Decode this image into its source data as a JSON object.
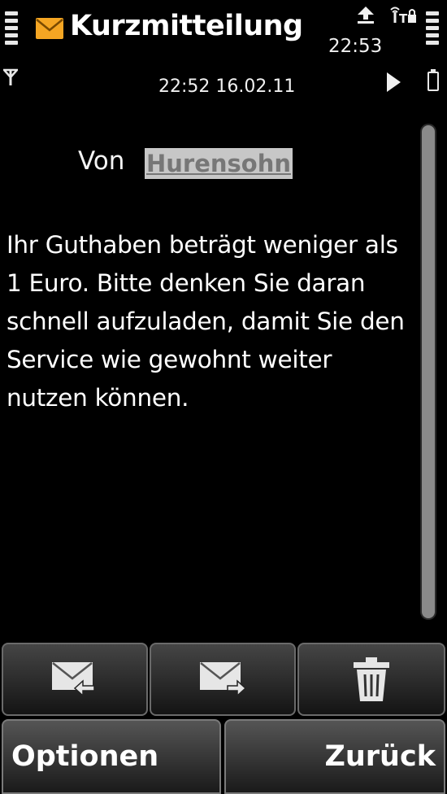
{
  "header": {
    "title": "Kurzmitteilung",
    "clock": "22:53",
    "datetime": "22:52 16.02.11"
  },
  "message": {
    "from_label": "Von",
    "sender": "Hurensohn",
    "body": "Ihr Guthaben beträgt weniger als\n1 Euro. Bitte denken Sie daran\nschnell aufzuladen, damit Sie den\nService wie gewohnt weiter\nnutzen können."
  },
  "toolbar": {
    "icons": [
      "reply-icon",
      "forward-icon",
      "trash-icon"
    ]
  },
  "softkeys": {
    "left": "Optionen",
    "right": "Zurück"
  },
  "colors": {
    "accent": "#f5a623",
    "background": "#000000",
    "highlight": "#c7c7c7"
  }
}
